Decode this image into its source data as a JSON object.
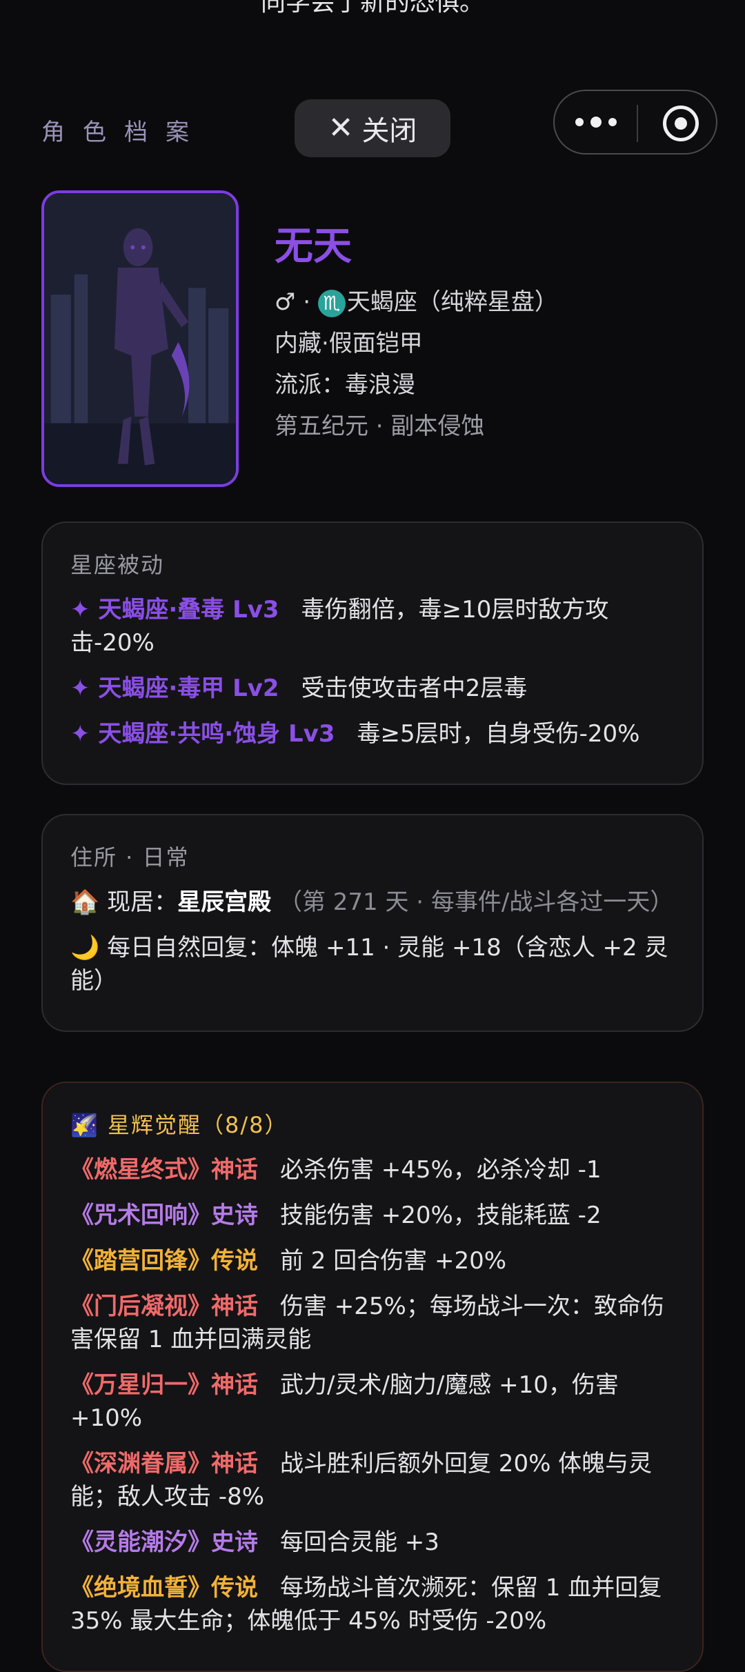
{
  "top_text": "同学会了新的恐惧。",
  "header": {
    "section_label": "角色档案",
    "close_label": "关闭",
    "close_icon": "close-icon",
    "more_icon": "more-dots-icon",
    "capsule_icon": "target-icon"
  },
  "profile": {
    "name": "无天",
    "gender_symbol": "♂",
    "separator": "·",
    "zodiac_glyph": "♏",
    "zodiac_text": "天蝎座（纯粹星盘）",
    "trait": "内藏·假面铠甲",
    "school": "流派：毒浪漫",
    "era": "第五纪元 · 副本侵蚀",
    "portrait": "armored-knight-portrait"
  },
  "passive": {
    "title": "星座被动",
    "items": [
      {
        "name": "✦ 天蝎座·叠毒 Lv3",
        "desc": "毒伤翻倍，毒≥10层时敌方攻击-20%"
      },
      {
        "name": "✦ 天蝎座·毒甲 Lv2",
        "desc": "受击使攻击者中2层毒"
      },
      {
        "name": "✦ 天蝎座·共鸣·蚀身 Lv3",
        "desc": "毒≥5层时，自身受伤-20%"
      }
    ]
  },
  "residence": {
    "title": "住所 · 日常",
    "home_icon": "🏠",
    "home_label": "现居：",
    "home_name": "星辰宫殿",
    "home_note": "（第 271 天 · 每事件/战斗各过一天）",
    "moon_icon": "🌙",
    "recovery": "每日自然回复：体魄 +11 · 灵能 +18（含恋人 +2 灵能）"
  },
  "awakening": {
    "icon": "🌠",
    "title": "星辉觉醒（8/8）",
    "items": [
      {
        "name": "《燃星终式》神话",
        "rarity": "myth",
        "desc": "必杀伤害 +45%，必杀冷却 -1"
      },
      {
        "name": "《咒术回响》史诗",
        "rarity": "epic",
        "desc": "技能伤害 +20%，技能耗蓝 -2"
      },
      {
        "name": "《踏营回锋》传说",
        "rarity": "leg",
        "desc": "前 2 回合伤害 +20%"
      },
      {
        "name": "《门后凝视》神话",
        "rarity": "myth",
        "desc": "伤害 +25%；每场战斗一次：致命伤害保留 1 血并回满灵能"
      },
      {
        "name": "《万星归一》神话",
        "rarity": "myth",
        "desc": "武力/灵术/脑力/魔感 +10，伤害 +10%"
      },
      {
        "name": "《深渊眷属》神话",
        "rarity": "myth",
        "desc": "战斗胜利后额外回复 20% 体魄与灵能；敌人攻击 -8%"
      },
      {
        "name": "《灵能潮汐》史诗",
        "rarity": "epic",
        "desc": "每回合灵能 +3"
      },
      {
        "name": "《绝境血誓》传说",
        "rarity": "leg",
        "desc": "每场战斗首次濒死：保留 1 血并回复 35% 最大生命；体魄低于 45% 时受伤 -20%"
      }
    ]
  },
  "colors": {
    "accent_purple": "#8b4fe6",
    "myth_red": "#f06a6a",
    "epic_purple": "#b57be8",
    "legend_gold": "#f2b23a"
  }
}
